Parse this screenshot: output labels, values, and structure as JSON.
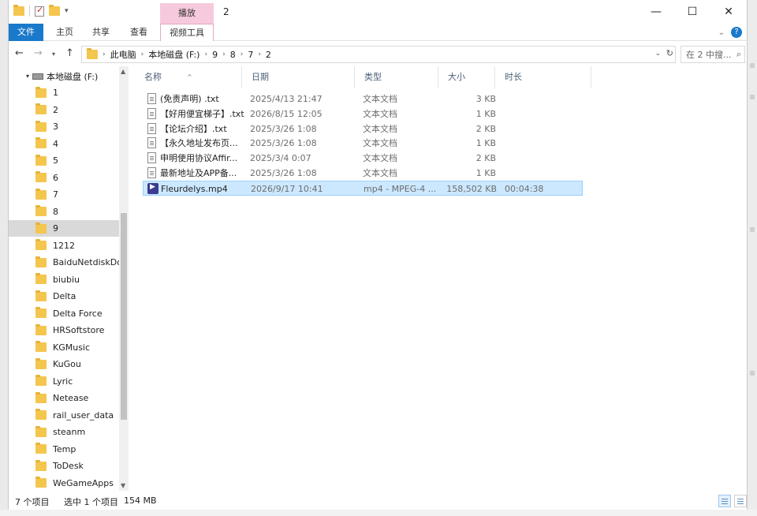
{
  "window": {
    "title": "2",
    "context_tab_group": "播放",
    "minimize_glyph": "—",
    "maximize_glyph": "☐",
    "close_glyph": "✕"
  },
  "ribbon": {
    "tabs": [
      {
        "label": "文件"
      },
      {
        "label": "主页"
      },
      {
        "label": "共享"
      },
      {
        "label": "查看"
      },
      {
        "label": "视频工具"
      }
    ]
  },
  "address": {
    "crumbs": [
      "此电脑",
      "本地磁盘 (F:)",
      "9",
      "8",
      "7",
      "2"
    ]
  },
  "search": {
    "placeholder": "在 2 中搜..."
  },
  "navigation": {
    "drive_label": "本地磁盘 (F:)",
    "items": [
      {
        "label": "1"
      },
      {
        "label": "2"
      },
      {
        "label": "3"
      },
      {
        "label": "4"
      },
      {
        "label": "5"
      },
      {
        "label": "6"
      },
      {
        "label": "7"
      },
      {
        "label": "8"
      },
      {
        "label": "9",
        "selected": true
      },
      {
        "label": "1212"
      },
      {
        "label": "BaiduNetdiskDo"
      },
      {
        "label": "biubiu"
      },
      {
        "label": "Delta"
      },
      {
        "label": "Delta Force"
      },
      {
        "label": "HRSoftstore"
      },
      {
        "label": "KGMusic"
      },
      {
        "label": "KuGou"
      },
      {
        "label": "Lyric"
      },
      {
        "label": "Netease"
      },
      {
        "label": "rail_user_data"
      },
      {
        "label": "steanm"
      },
      {
        "label": "Temp"
      },
      {
        "label": "ToDesk"
      },
      {
        "label": "WeGameApps"
      }
    ]
  },
  "columns": {
    "name": "名称",
    "date": "日期",
    "type": "类型",
    "size": "大小",
    "duration": "时长"
  },
  "files": [
    {
      "name": "(免责声明) .txt",
      "date": "2025/4/13 21:47",
      "type": "文本文档",
      "size": "3 KB",
      "duration": "",
      "icon": "text-file-icon"
    },
    {
      "name": "【好用便宜梯子】.txt",
      "date": "2026/8/15 12:05",
      "type": "文本文档",
      "size": "1 KB",
      "duration": "",
      "icon": "text-file-icon"
    },
    {
      "name": "【论坛介绍】.txt",
      "date": "2025/3/26 1:08",
      "type": "文本文档",
      "size": "2 KB",
      "duration": "",
      "icon": "text-file-icon"
    },
    {
      "name": "【永久地址发布页...",
      "date": "2025/3/26 1:08",
      "type": "文本文档",
      "size": "1 KB",
      "duration": "",
      "icon": "text-file-icon"
    },
    {
      "name": "申明使用协议Affir...",
      "date": "2025/3/4 0:07",
      "type": "文本文档",
      "size": "2 KB",
      "duration": "",
      "icon": "text-file-icon"
    },
    {
      "name": "最新地址及APP备...",
      "date": "2025/3/26 1:08",
      "type": "文本文档",
      "size": "1 KB",
      "duration": "",
      "icon": "text-file-icon"
    },
    {
      "name": "Fleurdelys.mp4",
      "date": "2026/9/17 10:41",
      "type": "mp4 - MPEG-4 ...",
      "size": "158,502 KB",
      "duration": "00:04:38",
      "icon": "video-file-icon",
      "selected": true
    }
  ],
  "status": {
    "item_count": "7 个项目",
    "selected": "选中 1 个项目",
    "selected_size": "154 MB"
  }
}
